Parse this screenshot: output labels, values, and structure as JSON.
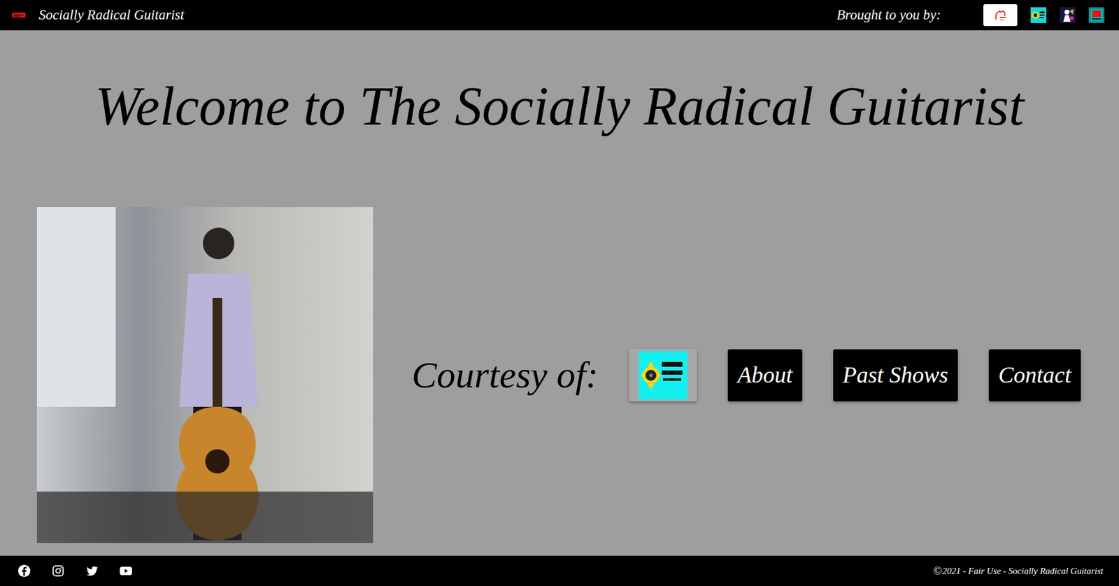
{
  "navbar": {
    "brand": "Socially Radical Guitarist",
    "sponsors_label": "Brought to you by:"
  },
  "heading": "Welcome to The Socially Radical Guitarist",
  "courtesy_label": "Courtesy of:",
  "buttons": [
    "About",
    "Past Shows",
    "Contact"
  ],
  "footer": {
    "copyright_symbol": "©",
    "copyright": "2021 - Fair Use - Socially Radical Guitarist"
  }
}
